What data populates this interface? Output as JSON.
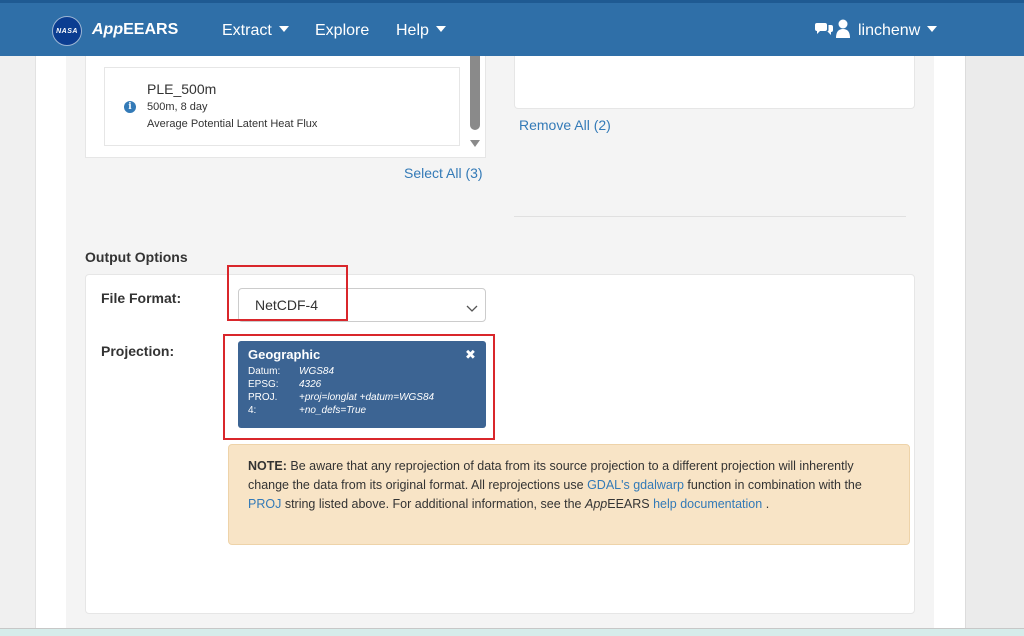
{
  "navbar": {
    "logo_text": "NASA",
    "brand_prefix": "App",
    "brand_suffix": "EEARS",
    "extract_label": "Extract",
    "explore_label": "Explore",
    "help_label": "Help",
    "user_name": "linchenw",
    "colors": {
      "bar": "#2f6fa8"
    }
  },
  "layers": {
    "item": {
      "name": "PLE_500m",
      "resolution": "500m, 8 day",
      "description": "Average Potential Latent Heat Flux",
      "info_icon": "info-circle-icon"
    },
    "select_all_label": "Select All (3)"
  },
  "selected": {
    "remove_all_label": "Remove All (2)"
  },
  "output_options": {
    "title": "Output Options",
    "file_format_label": "File Format:",
    "file_format_value": "NetCDF-4",
    "projection_label": "Projection:",
    "projection": {
      "title": "Geographic",
      "close_symbol": "✖",
      "rows": [
        {
          "key": "Datum:",
          "value": "WGS84"
        },
        {
          "key": "EPSG:",
          "value": "4326"
        },
        {
          "key": "PROJ.",
          "value": "+proj=longlat +datum=WGS84"
        },
        {
          "key": "4:",
          "value": "+no_defs=True"
        }
      ],
      "color": "#3c6493"
    },
    "note": {
      "label": "NOTE:",
      "text1": " Be aware that any reprojection of data from its source projection to a different projection will inherently change the data from its original format. All reprojections use ",
      "link1": "GDAL's gdalwarp",
      "text2": " function in combination with the ",
      "link2": "PROJ",
      "text3": " string listed above. For additional information, see the ",
      "app_italic": "App",
      "app_rest": "EEARS",
      "space": " ",
      "link3": "help documentation",
      "text4": " .",
      "bg_color": "#f8e4c6"
    },
    "highlight_color": "#d9262b"
  }
}
